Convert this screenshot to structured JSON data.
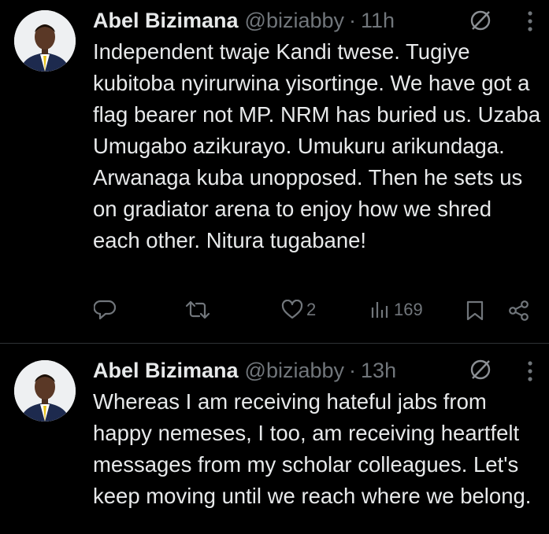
{
  "tweets": [
    {
      "author_name": "Abel Bizimana",
      "handle": "@biziabby",
      "separator": "·",
      "time": "11h",
      "text": "Independent twaje Kandi twese. Tugiye kubitoba nyirurwina yisortinge. We have got a flag bearer not MP. NRM has buried us. Uzaba Umugabo azikurayo. Umukuru arikundaga. Arwanaga kuba unopposed. Then he sets us on gradiator arena to enjoy how we shred each other. Nitura tugabane!",
      "likes": "2",
      "views": "169"
    },
    {
      "author_name": "Abel Bizimana",
      "handle": "@biziabby",
      "separator": "·",
      "time": "13h",
      "text": "Whereas I am receiving hateful jabs from happy nemeses, I too, am receiving heartfelt messages from my scholar colleagues. Let's keep moving until we reach where we belong."
    }
  ],
  "icons": {
    "reply": "reply-icon",
    "retweet": "retweet-icon",
    "like": "heart-icon",
    "views": "views-icon",
    "bookmark": "bookmark-icon",
    "share": "share-icon",
    "grok": "grok-icon",
    "more": "more-icon"
  },
  "colors": {
    "background": "#000000",
    "text": "#e7e9ea",
    "muted": "#71767b",
    "divider": "#2f3336"
  }
}
